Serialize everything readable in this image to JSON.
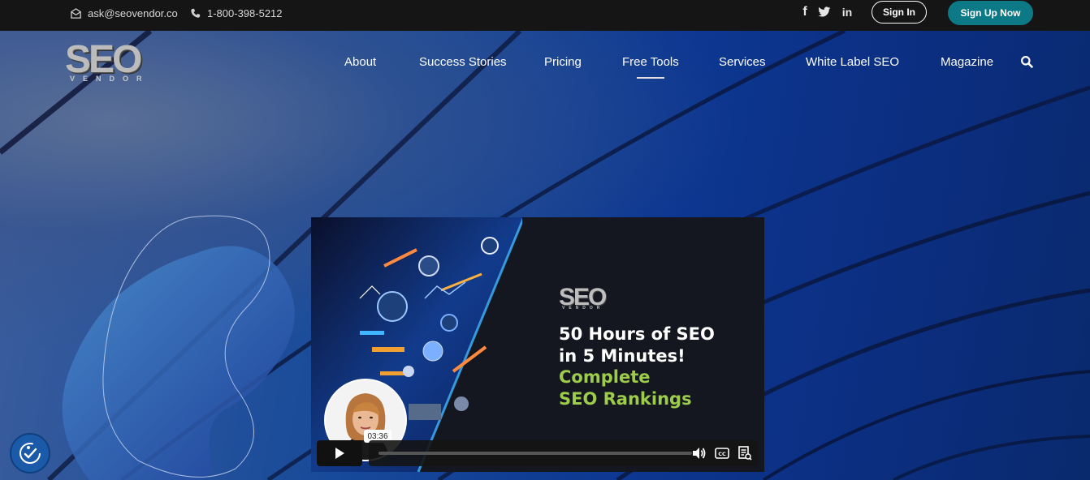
{
  "topbar": {
    "email": "ask@seovendor.co",
    "phone": "1-800-398-5212",
    "social": [
      "facebook-icon",
      "twitter-icon",
      "linkedin-icon"
    ],
    "signin_label": "Sign In",
    "signup_label": "Sign Up Now",
    "signup_color": "#0b7a86"
  },
  "logo": {
    "main": "SEO",
    "sub": "VENDOR"
  },
  "nav": {
    "items": [
      "About",
      "Success Stories",
      "Pricing",
      "Free Tools",
      "Services",
      "White Label SEO",
      "Magazine"
    ],
    "active": "Free Tools",
    "search_icon": "search-icon"
  },
  "video": {
    "logo_main": "SEO",
    "logo_sub": "VENDOR",
    "line1": "50 Hours of SEO",
    "line2": "in 5 Minutes!",
    "line3": "Complete",
    "line4": "SEO Rankings",
    "highlight_color": "#9ccc4a",
    "duration": "03:36",
    "controls": [
      "play-icon",
      "volume-icon",
      "captions-icon",
      "transcript-icon"
    ]
  },
  "accessibility": {
    "icon": "accessibility-icon"
  }
}
